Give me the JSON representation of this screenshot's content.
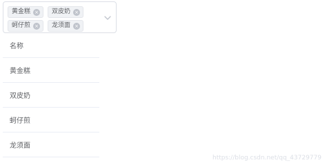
{
  "select": {
    "tags": [
      {
        "label": "黄金糕",
        "remove_icon": "x"
      },
      {
        "label": "双皮奶",
        "remove_icon": "x"
      },
      {
        "label": "蚵仔煎",
        "remove_icon": "x"
      },
      {
        "label": "龙须面",
        "remove_icon": "x"
      }
    ],
    "dropdown_icon": "chevron-down-icon"
  },
  "table": {
    "header": "名称",
    "rows": [
      "黄金糕",
      "双皮奶",
      "蚵仔煎",
      "龙须面"
    ]
  },
  "watermark": "https://blog.csdn.net/qq_43729779"
}
